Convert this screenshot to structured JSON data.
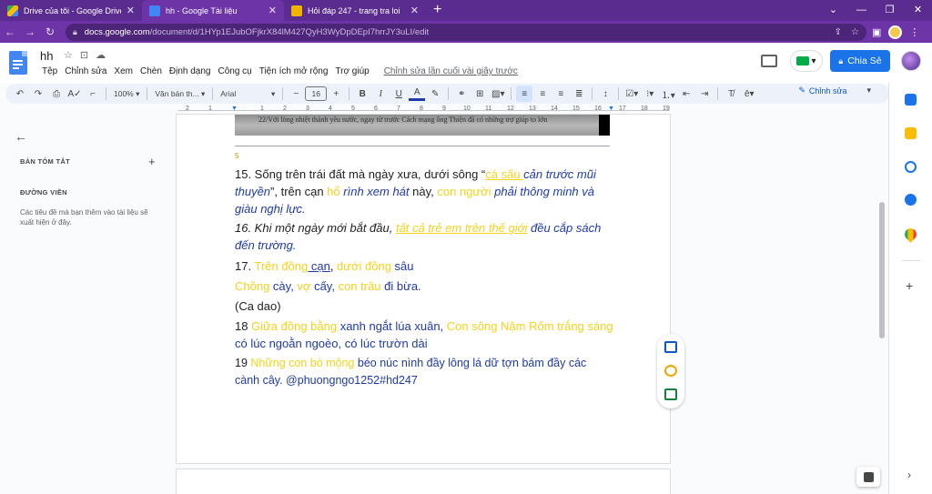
{
  "browser": {
    "tabs": [
      {
        "title": "Drive của tôi - Google Drive",
        "icon": "drive-icon",
        "color": "#fbbc04",
        "active": false
      },
      {
        "title": "hh - Google Tài liệu",
        "icon": "docs-icon",
        "color": "#4285f4",
        "active": true
      },
      {
        "title": "Hỏi đáp 247 - trang tra loi",
        "icon": "hoidap-icon",
        "color": "#f2b400",
        "active": false
      }
    ],
    "url_domain": "docs.google.com",
    "url_path": "/document/d/1HYp1EJubOFjkrX84lM427QyH3WyDpDEpI7hrrJY3uLI/edit"
  },
  "doc": {
    "title": "hh",
    "menu": [
      "Tệp",
      "Chỉnh sửa",
      "Xem",
      "Chèn",
      "Định dạng",
      "Công cụ",
      "Tiện ích mở rộng",
      "Trợ giúp"
    ],
    "last_edit": "Chỉnh sửa lần cuối vài giây trước",
    "share_label": "Chia Sẻ"
  },
  "toolbar": {
    "zoom": "100%",
    "style": "Văn bản th...",
    "font": "Arial",
    "font_size": "16",
    "mode": "Chỉnh sửa"
  },
  "ruler": [
    "2",
    "1",
    "1",
    "2",
    "3",
    "4",
    "5",
    "6",
    "7",
    "8",
    "9",
    "10",
    "11",
    "12",
    "13",
    "14",
    "15",
    "16",
    "17",
    "18",
    "19"
  ],
  "outline": {
    "summary_heading": "BẢN TÓM TẮT",
    "outline_heading": "ĐƯỜNG VIỀN",
    "outline_desc": "Các tiêu đề mà bạn thêm vào tài liệu sẽ xuất hiện ở đây."
  },
  "content": {
    "scan_text": "22/Với lòng nhiệt thành yêu nước, ngay từ trước Cách mạng ông Thiện đã có những trợ giúp to lớn",
    "page_num": "5",
    "p15": {
      "a": " 15. Sống trên trái đất mà ngày xưa, dưới sông “",
      "b": "cá sấu ",
      "c": "cản trước mũi thuyền",
      "d": "”, trên cạn ",
      "e": "hổ",
      "f": " rình xem hát",
      "g": " này, ",
      "h": "con người",
      "i": " phải thông minh và giàu nghị lực."
    },
    "p16": {
      "a": "16. Khi một ngày mới bắt đầu, ",
      "b": "tất cả trẻ em trên thế giới",
      "c": " đều cắp sách đến trường."
    },
    "p17a": {
      "a": "17. ",
      "b": "Trên đồng",
      "c": " cạn",
      "d": ", ",
      "e": "dưới đồng",
      "f": " sâu"
    },
    "p17b": {
      "a": "Chồng",
      "b": " cày, ",
      "c": "vợ",
      "d": " cấy, ",
      "e": "con trâu",
      "f": " đi bừa."
    },
    "p17c": "(Ca dao)",
    "p18": {
      "a": "18 ",
      "b": "Giữa đồng bằng",
      "c": " xanh ngắt lúa xuân, ",
      "d": "Con sông Nậm Rốm trắng sáng",
      "e": " có lúc ngoằn ngoèo, có lúc trườn dài"
    },
    "p19": {
      "a": "19 ",
      "b": "Những con bò mộng",
      "c": " béo núc nình đầy lông lá dữ tợn bám đầy các cành cây. @phuongngo1252#hd247"
    }
  }
}
